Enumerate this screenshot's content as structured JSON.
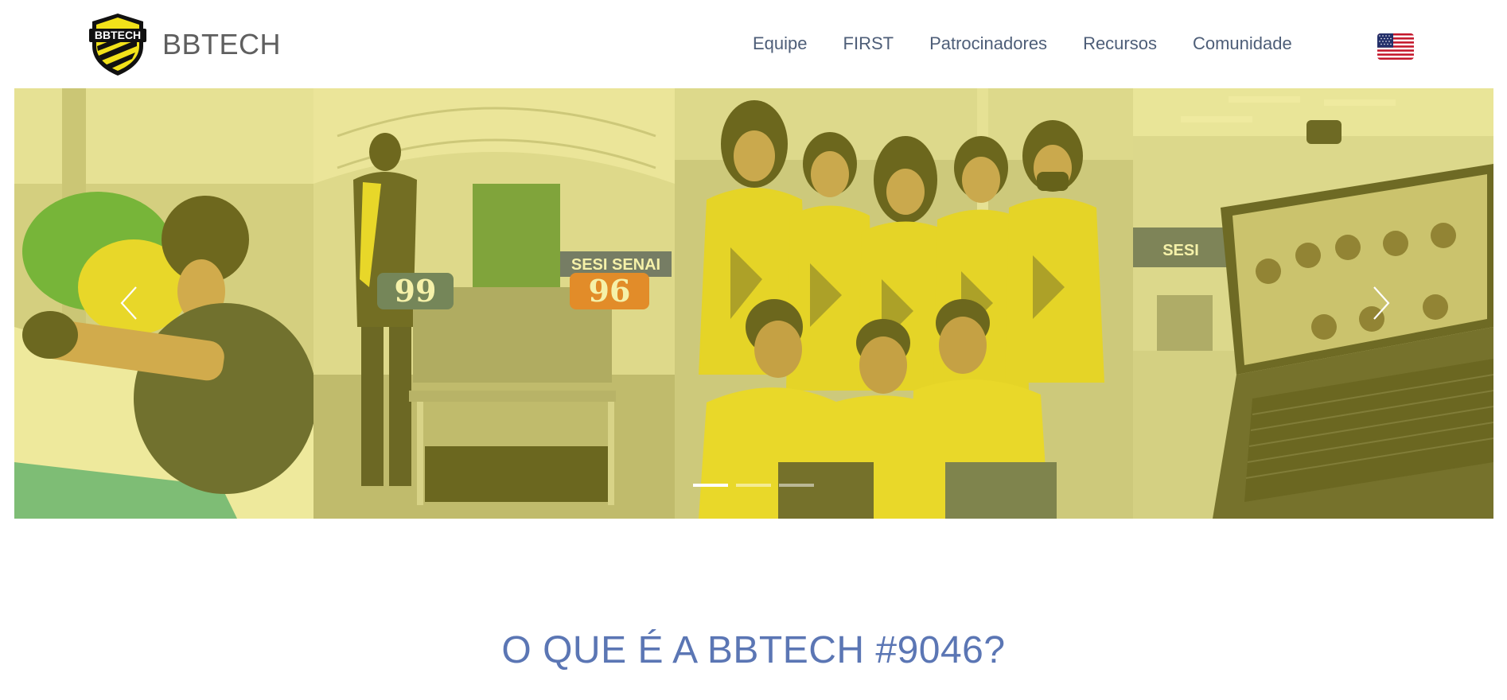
{
  "header": {
    "brand_name": "BBTECH",
    "logo_text": "BBTECH",
    "nav": [
      {
        "label": "Equipe"
      },
      {
        "label": "FIRST"
      },
      {
        "label": "Patrocinadores"
      },
      {
        "label": "Recursos"
      },
      {
        "label": "Comunidade"
      }
    ],
    "language_flag_icon": "us-flag-icon"
  },
  "carousel": {
    "slide_count": 3,
    "active_index": 0,
    "photo_labels": {
      "sign": "SESI SENAI",
      "bumper_left": "99",
      "bumper_right": "96",
      "wall_sign": "SESI"
    },
    "prev_icon": "chevron-left-icon",
    "next_icon": "chevron-right-icon",
    "overlay_color": "#e6dc28"
  },
  "section": {
    "title": "O QUE É A BBTECH #9046?"
  },
  "colors": {
    "brand_text": "#5f5f5f",
    "nav_text": "#4e5e78",
    "section_title": "#5b76b4",
    "logo_yellow": "#f2e21a"
  }
}
